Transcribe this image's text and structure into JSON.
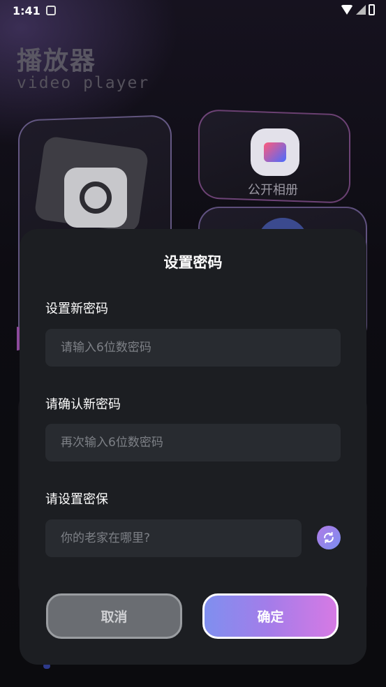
{
  "status_bar": {
    "time": "1:41"
  },
  "app": {
    "title": "播放器",
    "subtitle": "video player"
  },
  "cards": {
    "public_album_label": "公开相册"
  },
  "dialog": {
    "title": "设置密码",
    "new_password": {
      "label": "设置新密码",
      "placeholder": "请输入6位数密码",
      "value": ""
    },
    "confirm_password": {
      "label": "请确认新密码",
      "placeholder": "再次输入6位数密码",
      "value": ""
    },
    "security": {
      "label": "请设置密保",
      "placeholder": "你的老家在哪里?",
      "value": ""
    },
    "cancel_label": "取消",
    "confirm_label": "确定"
  },
  "colors": {
    "dialog_bg": "#1c1e22",
    "input_bg": "#282b30",
    "cancel_bg": "#6a6d72",
    "confirm_gradient_start": "#7f8fef",
    "confirm_gradient_end": "#d67ae4"
  },
  "icons": {
    "camera": "camera-icon",
    "public_album": "image-icon",
    "refresh": "refresh-icon",
    "wifi": "wifi-icon",
    "signal": "signal-icon",
    "battery": "battery-icon"
  }
}
